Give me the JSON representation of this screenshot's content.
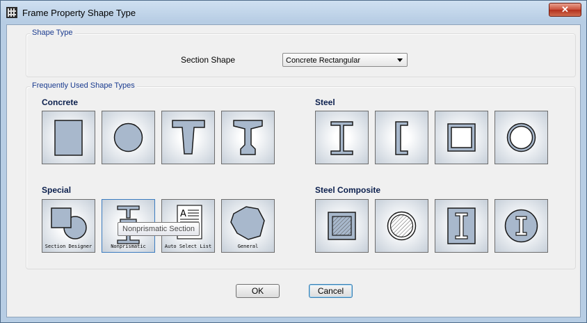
{
  "window": {
    "title": "Frame Property Shape Type",
    "close_label": "✕"
  },
  "shape_type": {
    "group_title": "Shape Type",
    "section_label": "Section Shape",
    "section_value": "Concrete Rectangular"
  },
  "frequent": {
    "group_title": "Frequently Used Shape Types",
    "categories": {
      "concrete": "Concrete",
      "steel": "Steel",
      "special": "Special",
      "steel_composite": "Steel Composite"
    },
    "special_captions": [
      "Section Designer",
      "Nonprismatic",
      "Auto Select List",
      "General"
    ]
  },
  "tooltip": "Nonprismatic Section",
  "buttons": {
    "ok": "OK",
    "cancel": "Cancel"
  },
  "colors": {
    "shape_fill": "#a8b8cc",
    "group_title": "#1a3b8f"
  }
}
